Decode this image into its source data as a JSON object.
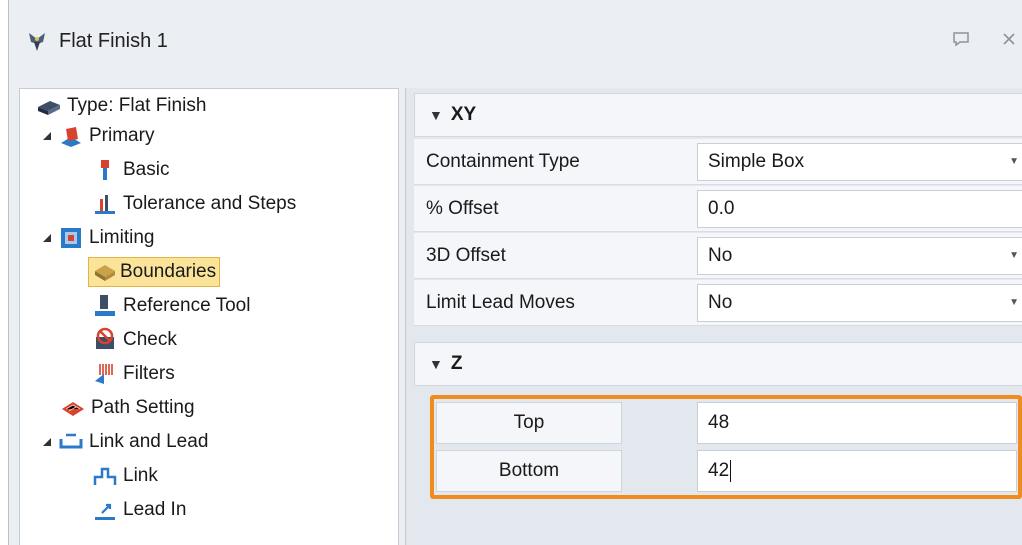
{
  "window": {
    "title": "Flat Finish 1",
    "icons": [
      "pin-icon",
      "close-icon"
    ]
  },
  "tree": {
    "items": [
      {
        "label": "Type: Flat Finish",
        "icon": "flat-finish-icon"
      },
      {
        "label": "Primary",
        "icon": "primary-icon",
        "expanded": true
      },
      {
        "label": "Basic",
        "icon": "basic-icon"
      },
      {
        "label": "Tolerance and Steps",
        "icon": "tolerance-icon"
      },
      {
        "label": "Limiting",
        "icon": "limiting-icon",
        "expanded": true
      },
      {
        "label": "Boundaries",
        "icon": "boundaries-icon",
        "selected": true
      },
      {
        "label": "Reference Tool",
        "icon": "reference-tool-icon"
      },
      {
        "label": "Check",
        "icon": "check-icon"
      },
      {
        "label": "Filters",
        "icon": "filters-icon"
      },
      {
        "label": "Path Setting",
        "icon": "path-setting-icon"
      },
      {
        "label": "Link and Lead",
        "icon": "link-lead-icon",
        "expanded": true
      },
      {
        "label": "Link",
        "icon": "link-icon"
      },
      {
        "label": "Lead In",
        "icon": "lead-in-icon"
      }
    ]
  },
  "props": {
    "xy": {
      "title": "XY",
      "rows": [
        {
          "label": "Containment Type",
          "value": "Simple Box",
          "dropdown": true
        },
        {
          "label": "% Offset",
          "value": "0.0",
          "dropdown": false
        },
        {
          "label": "3D Offset",
          "value": "No",
          "dropdown": true
        },
        {
          "label": "Limit Lead Moves",
          "value": "No",
          "dropdown": true
        }
      ]
    },
    "z": {
      "title": "Z",
      "top_label": "Top",
      "top_value": "48",
      "bottom_label": "Bottom",
      "bottom_value": "42"
    }
  },
  "colors": {
    "highlight": "#f08c1e",
    "selection": "#fbe39a"
  }
}
